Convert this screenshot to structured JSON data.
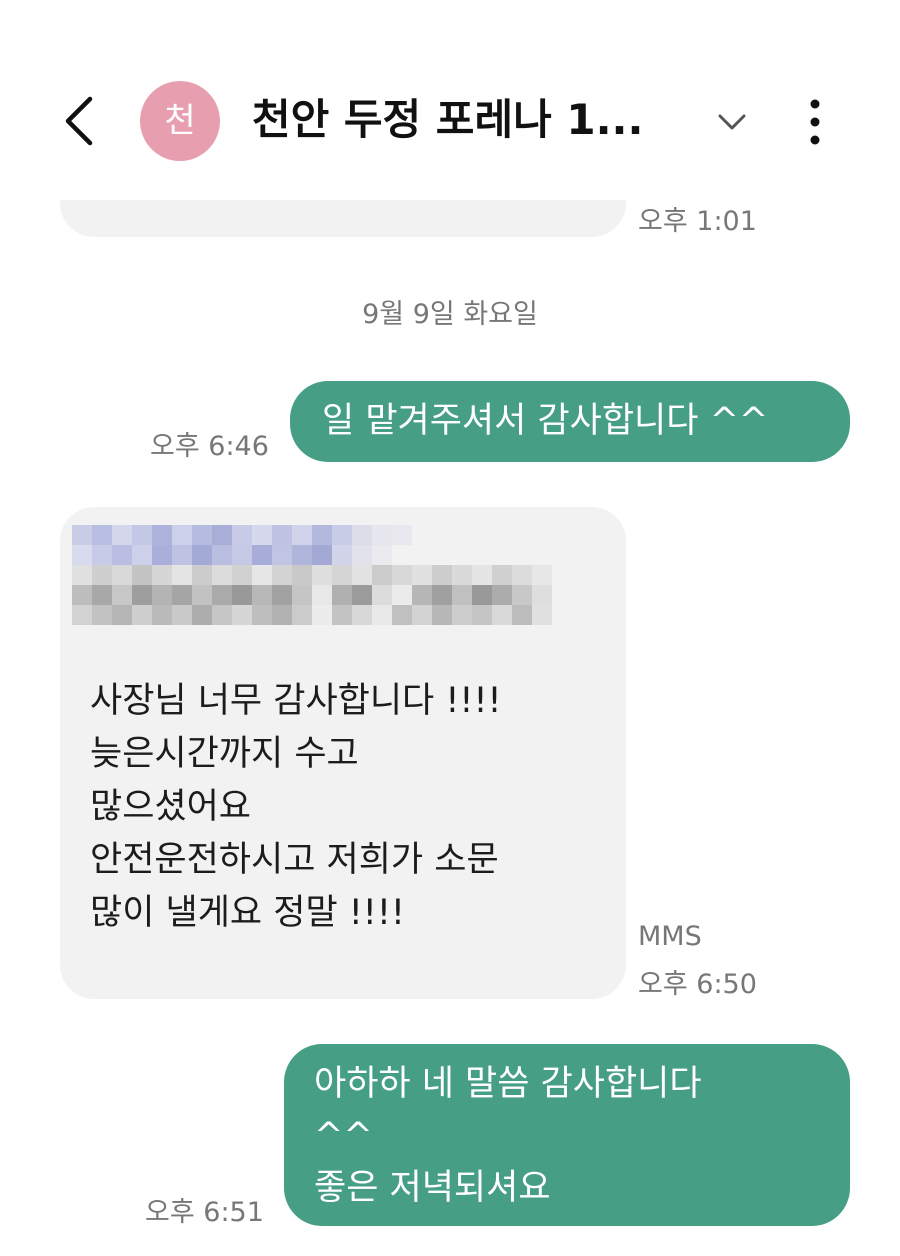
{
  "header": {
    "back_icon": "chevron-left-icon",
    "avatar_initial": "천",
    "avatar_color": "#e79eae",
    "title": "천안 두정 포레나 1...",
    "expand_icon": "chevron-down-icon",
    "more_icon": "more-vertical-icon"
  },
  "conversation": {
    "prev_message_time": "오후 1:01",
    "date_separator": "9월 9일 화요일",
    "messages": [
      {
        "direction": "outgoing",
        "text": "일 맡겨주셔서 감사합니다 ^^",
        "time": "오후 6:46"
      },
      {
        "direction": "incoming",
        "type": "MMS",
        "attachment_pixelated": true,
        "lines": [
          "사장님 너무 감사합니다 !!!!",
          "늦은시간까지 수고",
          "많으셨어요",
          "안전운전하시고 저희가 소문",
          "많이 낼게요 정말 !!!!"
        ],
        "type_label": "MMS",
        "time": "오후 6:50"
      },
      {
        "direction": "outgoing",
        "lines": [
          "아하하 네 말씀 감사합니다",
          "^^",
          "좋은 저녁되셔요"
        ],
        "time": "오후 6:51"
      }
    ]
  },
  "colors": {
    "outgoing_bubble": "#469f85",
    "incoming_bubble": "#f2f2f2",
    "meta_text": "#777777"
  }
}
